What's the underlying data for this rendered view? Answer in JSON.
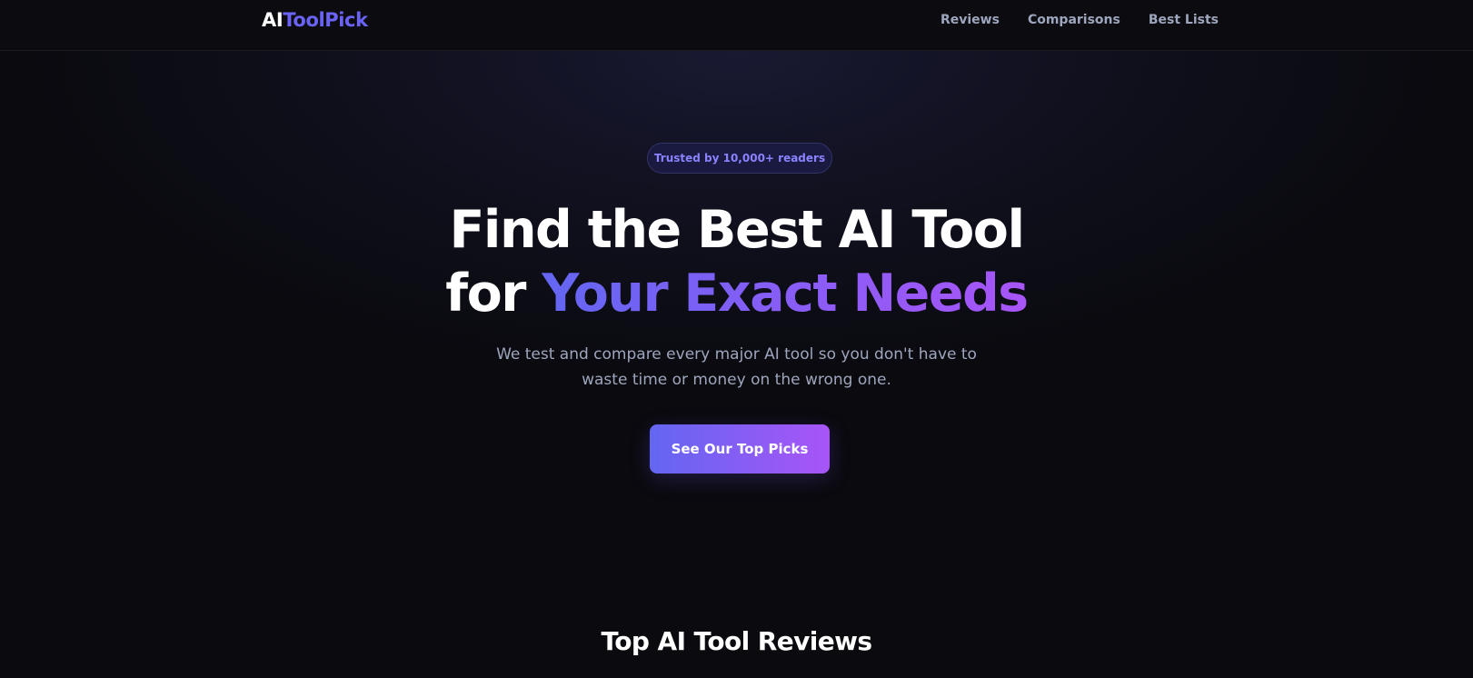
{
  "header": {
    "logo_part1": "AI",
    "logo_part2": "ToolPick",
    "nav": [
      {
        "label": "Reviews"
      },
      {
        "label": "Comparisons"
      },
      {
        "label": "Best Lists"
      }
    ]
  },
  "hero": {
    "badge": "Trusted by 10,000+ readers",
    "headline_line1": "Find the Best AI Tool",
    "headline_line2_prefix": "for ",
    "headline_line2_highlight": "Your Exact Needs",
    "subtitle_line1": "We test and compare every major AI tool so you don't have to",
    "subtitle_line2": "waste time or money on the wrong one.",
    "cta_label": "See Our Top Picks"
  },
  "reviews_section": {
    "title": "Top AI Tool Reviews"
  },
  "colors": {
    "background": "#0a0a0f",
    "accent_indigo": "#6366f1",
    "accent_purple": "#a855f7",
    "muted_text": "#9ea6bd"
  }
}
